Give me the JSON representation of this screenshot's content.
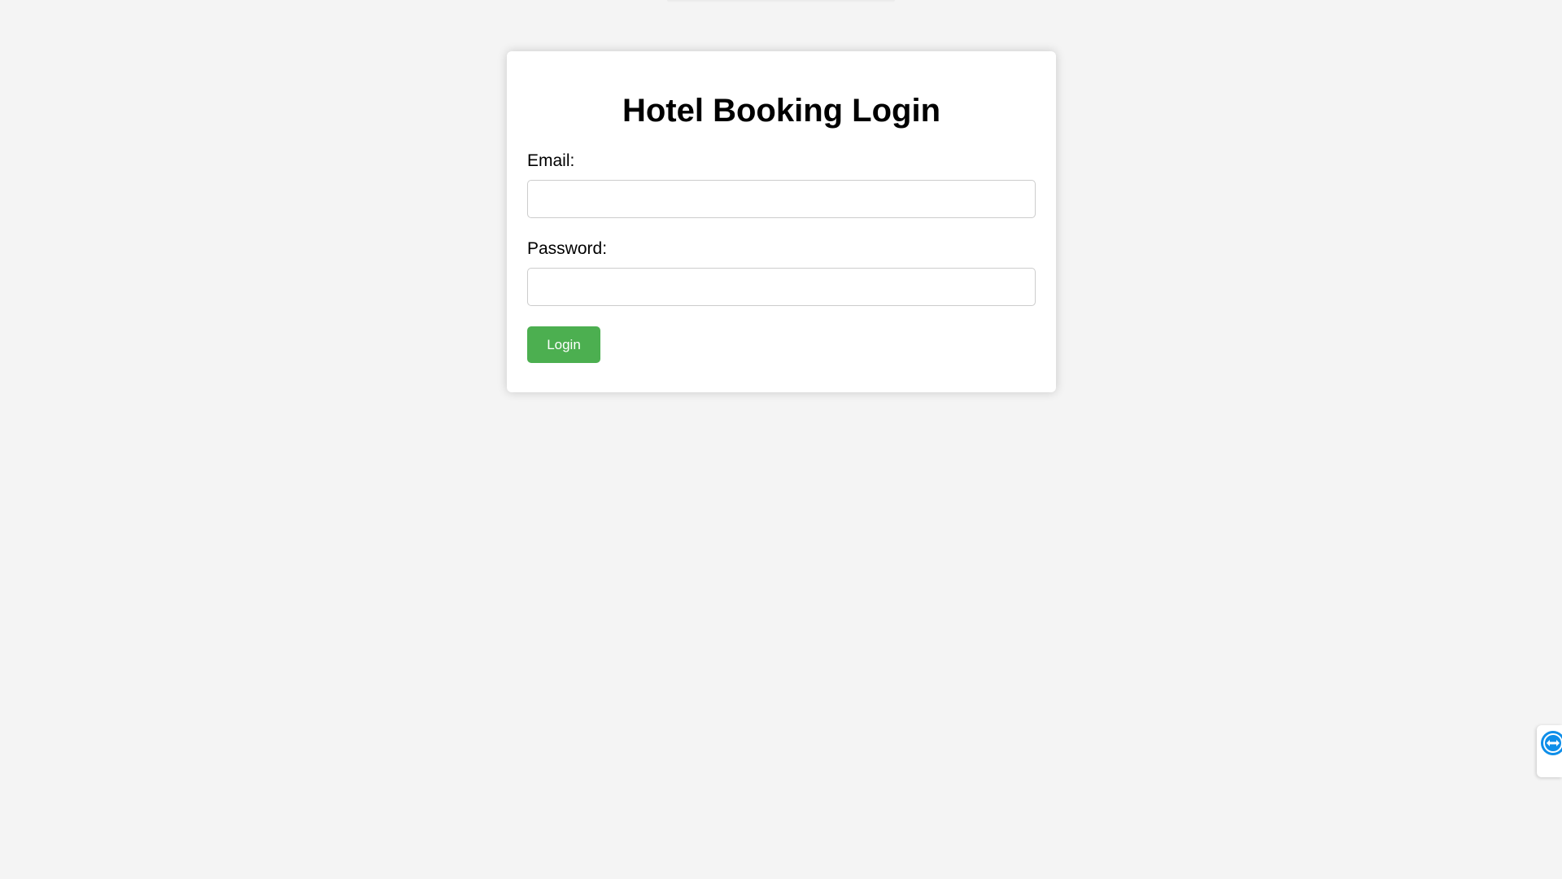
{
  "login_form": {
    "title": "Hotel Booking Login",
    "email_label": "Email:",
    "email_value": "",
    "password_label": "Password:",
    "password_value": "",
    "login_button_label": "Login"
  },
  "colors": {
    "background": "#f4f4f4",
    "card_background": "#ffffff",
    "login_button": "#4caf50",
    "remote_widget_accent": "#0e8ee9"
  },
  "icons": {
    "remote_support_widget": "remote-support-icon"
  }
}
